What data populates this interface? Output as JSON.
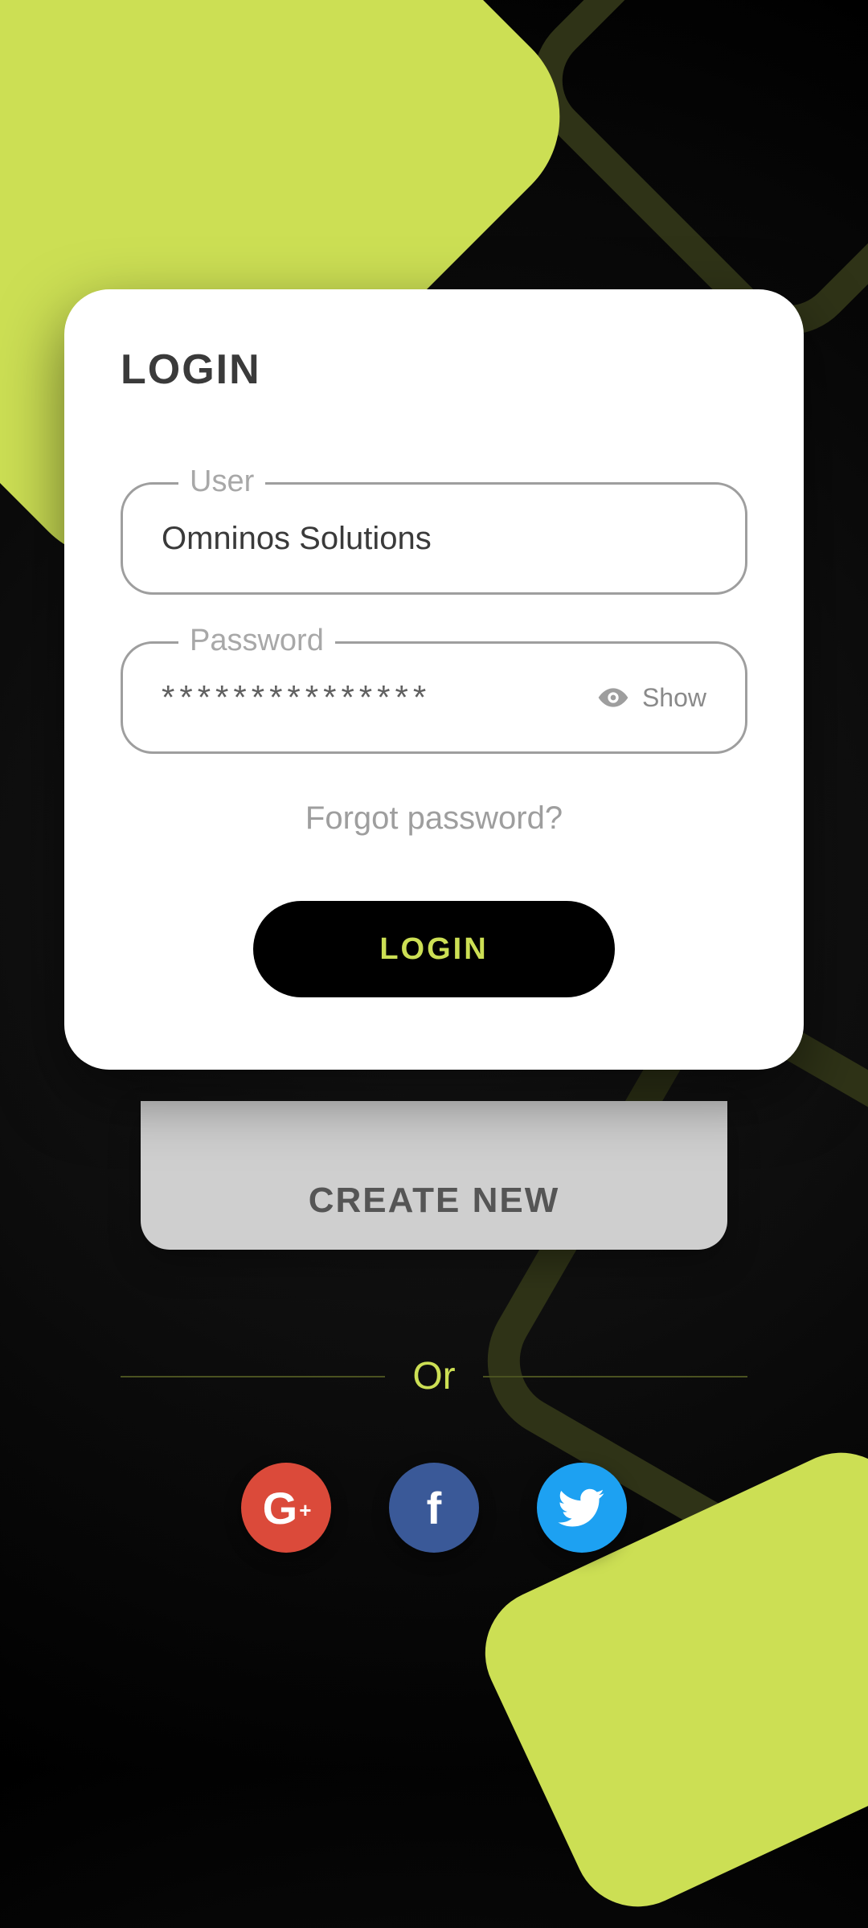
{
  "card": {
    "title": "LOGIN",
    "user_label": "User",
    "user_value": "Omninos Solutions",
    "password_label": "Password",
    "password_value": "***************",
    "show_label": "Show",
    "forgot": "Forgot password?",
    "login_button": "LOGIN"
  },
  "create_new": "CREATE NEW",
  "divider": "Or",
  "social": {
    "google": "G",
    "google_plus": "+",
    "facebook": "f",
    "twitter": ""
  },
  "colors": {
    "accent": "#ccdf54"
  }
}
